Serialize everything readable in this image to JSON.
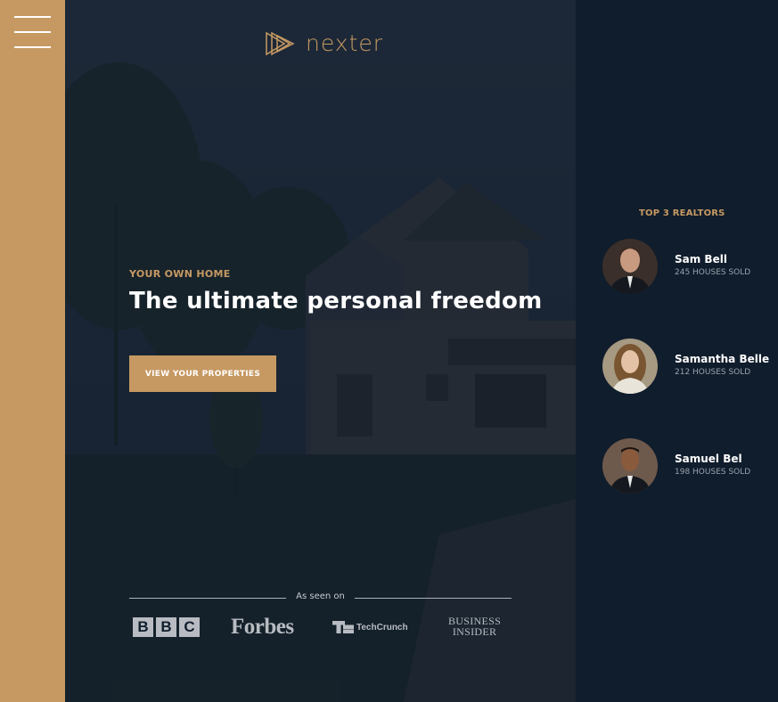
{
  "menu": {
    "icon": "hamburger-menu-icon"
  },
  "brand": {
    "logo_text": "nexter",
    "logo_icon": "triangles-play-icon",
    "accent": "#c69963"
  },
  "hero": {
    "subtitle": "YOUR OWN HOME",
    "title": "The ultimate personal freedom",
    "cta_label": "VIEW YOUR PROPERTIES"
  },
  "seen_on": {
    "label": "As seen on",
    "logos": {
      "bbc": [
        "B",
        "B",
        "C"
      ],
      "forbes": "Forbes",
      "techcrunch": "TechCrunch",
      "insider_line1": "BUSINESS",
      "insider_line2": "INSIDER"
    }
  },
  "realtors": {
    "title": "TOP 3 REALTORS",
    "items": [
      {
        "name": "Sam Bell",
        "sold": "245 HOUSES SOLD"
      },
      {
        "name": "Samantha Belle",
        "sold": "212 HOUSES SOLD"
      },
      {
        "name": "Samuel Bel",
        "sold": "198 HOUSES SOLD"
      }
    ]
  },
  "colors": {
    "dark": "#101d2c",
    "primary": "#c69963",
    "white": "#ffffff"
  }
}
